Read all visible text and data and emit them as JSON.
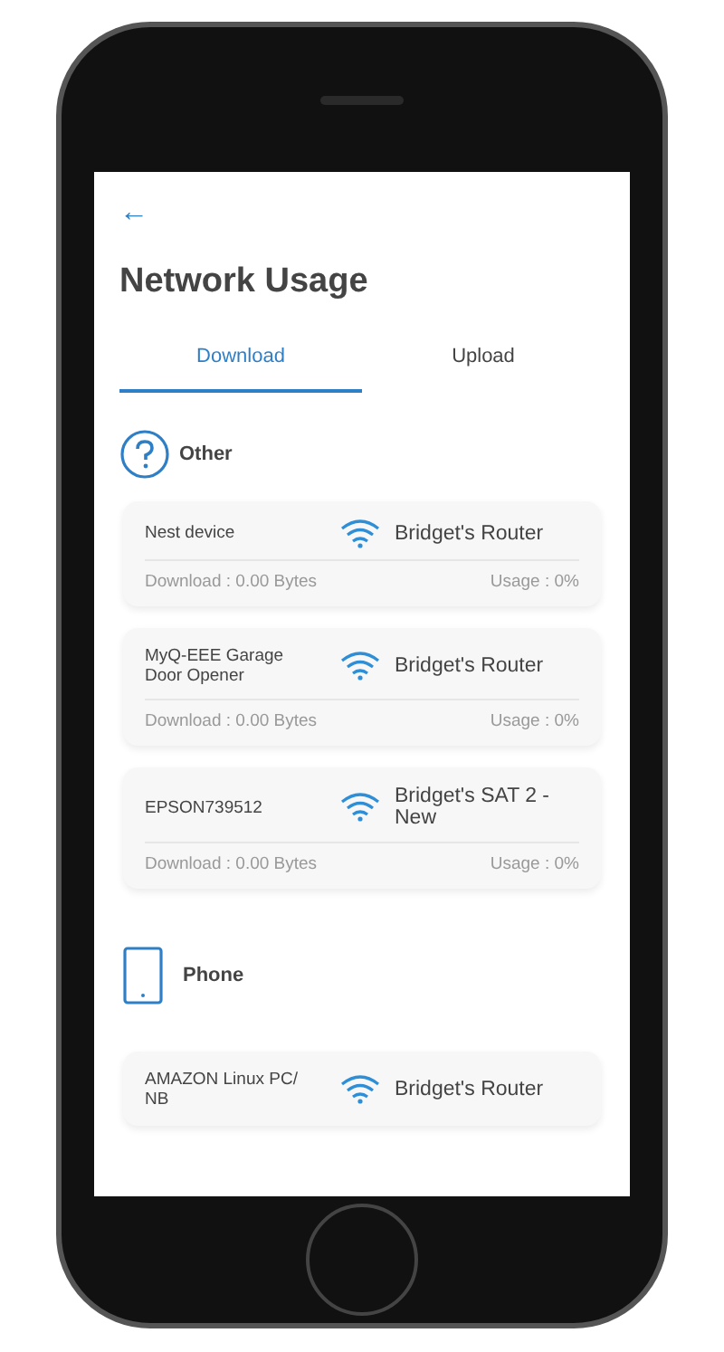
{
  "header": {
    "back": "←",
    "title": "Network Usage"
  },
  "tabs": [
    {
      "label": "Download",
      "selected": true
    },
    {
      "label": "Upload",
      "selected": false
    }
  ],
  "groups": [
    {
      "kind": "other",
      "label": "Other",
      "devices": [
        {
          "name": "Nest device",
          "network": "Bridget's Router",
          "download": "Download : 0.00 Bytes",
          "usage": "Usage : 0%"
        },
        {
          "name": "MyQ-EEE Garage Door Opener",
          "network": "Bridget's Router",
          "download": "Download : 0.00 Bytes",
          "usage": "Usage : 0%"
        },
        {
          "name": "EPSON739512",
          "network": "Bridget's SAT 2 - New",
          "download": "Download : 0.00 Bytes",
          "usage": "Usage : 0%"
        }
      ]
    },
    {
      "kind": "phone",
      "label": "Phone",
      "devices": [
        {
          "name": "AMAZON Linux PC/ NB",
          "network": "Bridget's Router"
        }
      ]
    }
  ]
}
